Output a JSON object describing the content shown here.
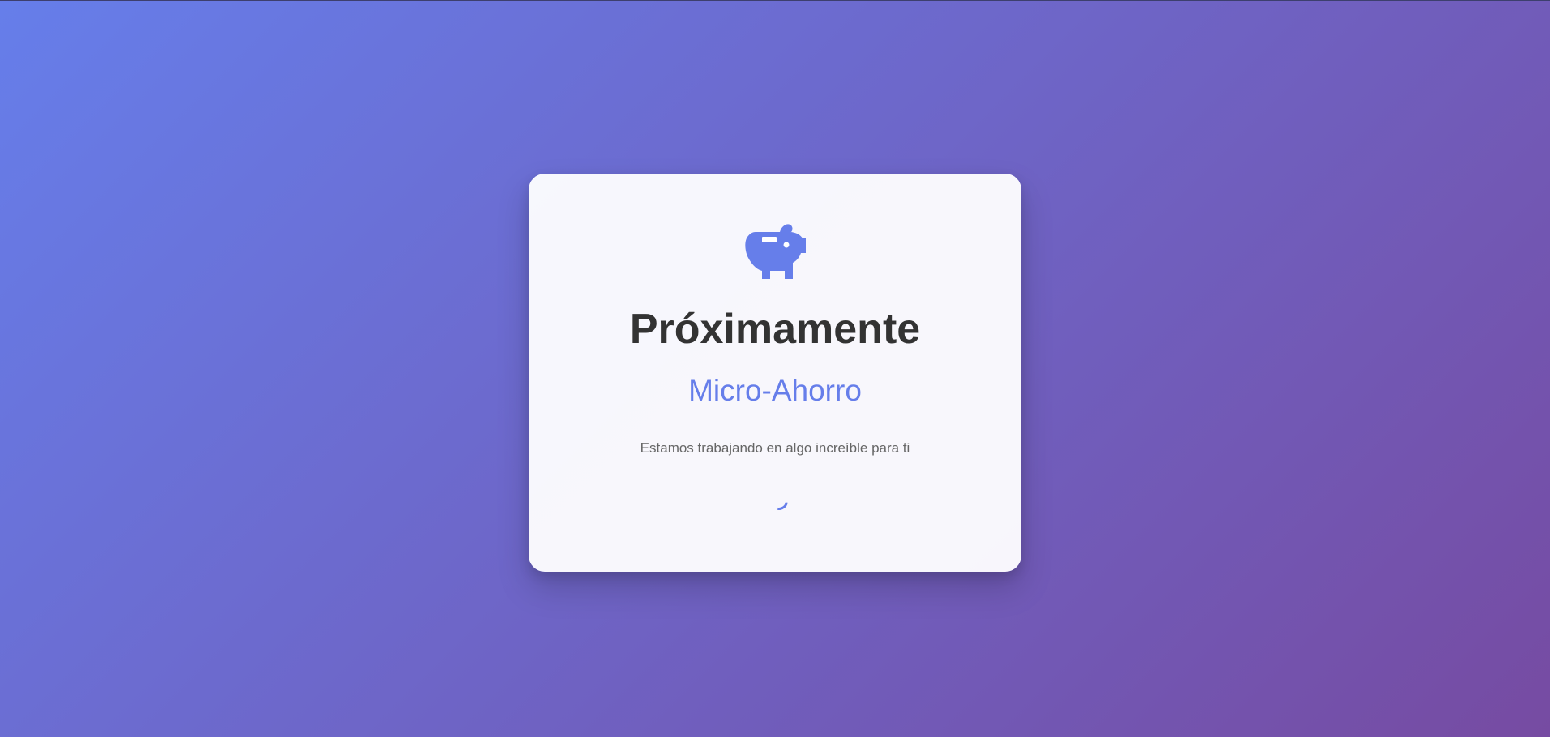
{
  "card": {
    "icon": "piggy-bank-icon",
    "title": "Próximamente",
    "subtitle": "Micro-Ahorro",
    "description": "Estamos trabajando en algo increíble para ti"
  },
  "spinner": "loading-spinner",
  "colors": {
    "gradient_start": "#667eea",
    "gradient_end": "#764ba2",
    "accent": "#667eea",
    "title": "#333333",
    "description": "#666666",
    "card_background": "#f8f8fc"
  }
}
